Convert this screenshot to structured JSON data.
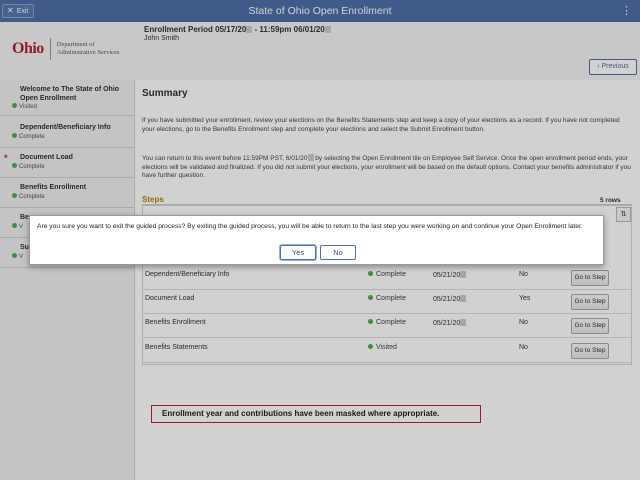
{
  "topbar": {
    "exit_label": "Exit",
    "title": "State of Ohio Open Enrollment",
    "menu_icon": "kebab-icon"
  },
  "header": {
    "logo_word": "Ohio",
    "logo_dept_line1": "Department of",
    "logo_dept_line2": "Administrative Services",
    "period_prefix": "Enrollment Period 05/17/20",
    "period_middle": " - 11:59pm 06/01/20",
    "user_name": "John Smith"
  },
  "nav": {
    "items": [
      {
        "title": "Welcome to The State of Ohio Open Enrollment",
        "status": "Visited",
        "required": false
      },
      {
        "title": "Dependent/Beneficiary Info",
        "status": "Complete",
        "required": false
      },
      {
        "title": "Document Load",
        "status": "Complete",
        "required": true
      },
      {
        "title": "Benefits Enrollment",
        "status": "Complete",
        "required": false
      },
      {
        "title": "Be",
        "status": "V",
        "required": false
      },
      {
        "title": "Su",
        "status": "V",
        "required": false
      }
    ]
  },
  "previous_label": "Previous",
  "summary": {
    "title": "Summary",
    "para1": "If you have submitted your enrollment, review your elections on the Benefits Statements step and keep a copy of your elections as a record. If you have not completed your elections, go to the Benefits Enrollment step and complete your elections and select the Submit Enrollment button.",
    "para2_a": "You can return to this event before 11:59PM PST, 6/01/20",
    "para2_b": " by selecting the Open Enrollment tile on Employee Self Service. Once the open enrollment period ends, your elections will be validated and finalized. If you did not submit your elections, your enrollment will be based on the default options.  Contact your benefits administrator if you have further question."
  },
  "steps": {
    "heading": "Steps",
    "rows_count": "5 rows",
    "go_label": "Go to Step",
    "rows": [
      {
        "name": "Dependent/Beneficiary Info",
        "status": "Complete",
        "date": "05/21/20",
        "flag": "No"
      },
      {
        "name": "Document Load",
        "status": "Complete",
        "date": "05/21/20",
        "flag": "Yes"
      },
      {
        "name": "Benefits Enrollment",
        "status": "Complete",
        "date": "05/21/20",
        "flag": "No"
      },
      {
        "name": "Benefits Statements",
        "status": "Visited",
        "date": "",
        "flag": "No"
      }
    ]
  },
  "modal": {
    "message": "Are you sure you want to exit the guided process? By exiting the guided process, you will be able to return to the last step you were working on and continue your Open Enrollment later.",
    "yes_label": "Yes",
    "no_label": "No"
  },
  "note": "Enrollment year and contributions have been masked where appropriate.",
  "colors": {
    "topbar": "#4f6fa8",
    "complete": "#4caf50",
    "required": "#c0202a",
    "steps_heading": "#b8860b"
  }
}
